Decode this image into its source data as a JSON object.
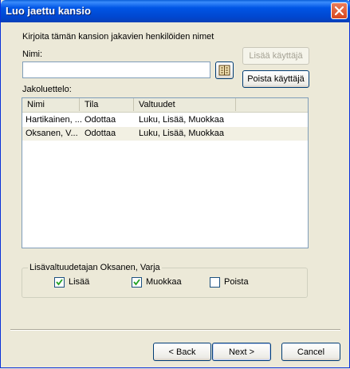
{
  "window": {
    "title": "Luo jaettu kansio"
  },
  "form": {
    "instruction": "Kirjoita tämän kansion jakavien henkilöiden nimet",
    "name_label": "Nimi:",
    "name_value": "",
    "add_user_label": "Lisää käyttäjä",
    "remove_user_label": "Poista käyttäjä",
    "share_list_label": "Jakoluettelo:"
  },
  "list": {
    "columns": [
      "Nimi",
      "Tila",
      "Valtuudet"
    ],
    "rows": [
      {
        "name": "Hartikainen, ...",
        "status": "Odottaa",
        "rights": "Luku, Lisää, Muokkaa"
      },
      {
        "name": "Oksanen, V...",
        "status": "Odottaa",
        "rights": "Luku, Lisää, Muokkaa"
      }
    ]
  },
  "permissions": {
    "group_title": "Lisävaltuudetajan Oksanen, Varja",
    "add_label": "Lisää",
    "add_checked": true,
    "edit_label": "Muokkaa",
    "edit_checked": true,
    "delete_label": "Poista",
    "delete_checked": false
  },
  "footer": {
    "back_label": "< Back",
    "next_label": "Next >",
    "cancel_label": "Cancel"
  }
}
